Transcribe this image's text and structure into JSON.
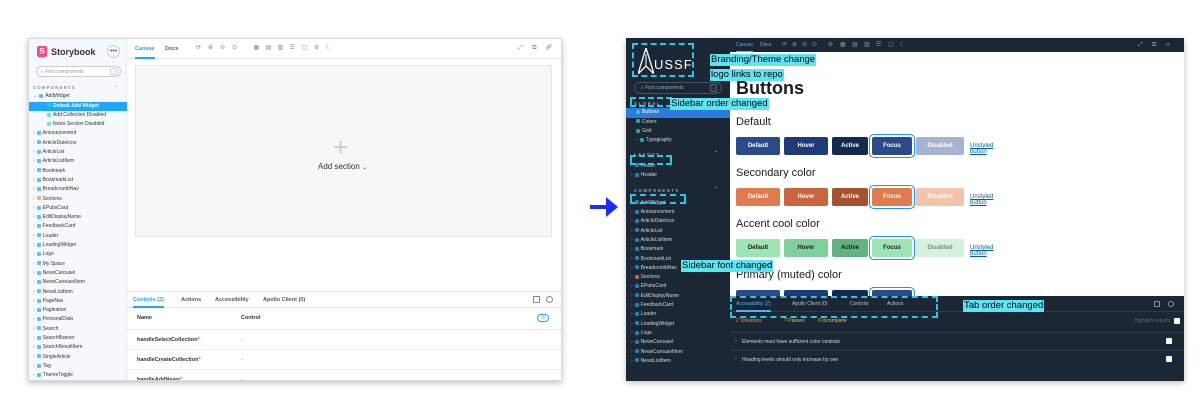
{
  "before": {
    "app_name": "Storybook",
    "search_placeholder": "Find components",
    "search_shortcut": "/",
    "sidebar_header": "COMPONENTS",
    "tree": [
      {
        "label": "AddWidget",
        "level": 0,
        "expanded": true
      },
      {
        "label": "Default Add Widget",
        "level": 2,
        "selected": true
      },
      {
        "label": "Add Collection Disabled",
        "level": 2
      },
      {
        "label": "News Section Disabled",
        "level": 2
      },
      {
        "label": "Announcement",
        "level": 0
      },
      {
        "label": "ArticleDateIcon",
        "level": 0
      },
      {
        "label": "ArticleList",
        "level": 0
      },
      {
        "label": "ArticleListItem",
        "level": 0
      },
      {
        "label": "Bookmark",
        "level": 0
      },
      {
        "label": "BookmarkList",
        "level": 0
      },
      {
        "label": "BreadcrumbNav",
        "level": 0
      },
      {
        "label": "Sections",
        "level": 0
      },
      {
        "label": "EPubsCard",
        "level": 0
      },
      {
        "label": "EditDisplayName",
        "level": 0
      },
      {
        "label": "FeedbackCard",
        "level": 0
      },
      {
        "label": "Loader",
        "level": 0
      },
      {
        "label": "LoadingWidget",
        "level": 0
      },
      {
        "label": "Logo",
        "level": 0
      },
      {
        "label": "My Space",
        "level": 0
      },
      {
        "label": "NewsCarousel",
        "level": 0
      },
      {
        "label": "NewsCarouselItem",
        "level": 0
      },
      {
        "label": "NewsListItem",
        "level": 0
      },
      {
        "label": "PageNav",
        "level": 0
      },
      {
        "label": "Pagination",
        "level": 0
      },
      {
        "label": "PersonalData",
        "level": 0
      },
      {
        "label": "Search",
        "level": 0
      },
      {
        "label": "SearchBanner",
        "level": 0
      },
      {
        "label": "SearchResultItem",
        "level": 0
      },
      {
        "label": "SingleArticle",
        "level": 0
      },
      {
        "label": "Tag",
        "level": 0
      },
      {
        "label": "ThemeToggle",
        "level": 0
      }
    ],
    "toolbar_tabs": [
      "Canvas",
      "Docs"
    ],
    "add_section": "Add section",
    "panel_tabs": [
      "Controls (2)",
      "Actions",
      "Accessibility",
      "Apollo Client (0)"
    ],
    "table_headers": [
      "Name",
      "Control"
    ],
    "controls": [
      {
        "name": "handleSelectCollection",
        "value": "-"
      },
      {
        "name": "handleCreateCollection",
        "value": "-"
      },
      {
        "name": "handleAddNews",
        "value": "-"
      }
    ]
  },
  "after": {
    "logo_text": "USSF",
    "search_placeholder": "Find components",
    "search_shortcut": "/",
    "groups": [
      {
        "header": "GLOBAL",
        "items": [
          "Buttons",
          "Colors",
          "Grid",
          "Typography"
        ]
      },
      {
        "header": "LAYOUT",
        "items": [
          "Footer",
          "Header"
        ]
      },
      {
        "header": "COMPONENTS",
        "items": [
          "AddWidget",
          "Announcement",
          "ArticleDateIcon",
          "ArticleList",
          "ArticleListItem",
          "Bookmark",
          "BookmarkList",
          "BreadcrumbNav",
          "Sections",
          "EPubsCard",
          "EditDisplayName",
          "FeedbackCard",
          "Loader",
          "LoadingWidget",
          "Logo",
          "NewsCarousel",
          "NewsCarouselItem",
          "NewsListItem"
        ]
      }
    ],
    "toolbar_tabs": [
      "Canvas",
      "Docs"
    ],
    "page_title": "Buttons",
    "sections": [
      {
        "title": "Default",
        "buttons": [
          "Default",
          "Hover",
          "Active",
          "Focus",
          "Disabled"
        ],
        "link": "Unstyled button"
      },
      {
        "title": "Secondary color",
        "buttons": [
          "Default",
          "Hover",
          "Active",
          "Focus",
          "Disabled"
        ],
        "link": "Unstyled button"
      },
      {
        "title": "Accent cool color",
        "buttons": [
          "Default",
          "Hover",
          "Active",
          "Focus",
          "Disabled"
        ],
        "link": "Unstyled button"
      },
      {
        "title": "Primary (muted) color"
      }
    ],
    "panel_tabs": [
      "Accessibility (2)",
      "Apollo Client (0)",
      "Controls",
      "Actions"
    ],
    "a11y": {
      "violations": "2 Violations",
      "passes": "7 Passes",
      "incomplete": "0 Incomplete",
      "highlight": "Highlight results"
    },
    "a11y_rows": [
      "Elements must have sufficient color contrast",
      "Heading levels should only increase by one"
    ]
  },
  "annotations": {
    "branding": "Branding/Theme change",
    "logo_link": "logo links to repo",
    "sidebar_order": "Sidebar order changed",
    "sidebar_font": "Sidebar font changed",
    "tab_order": "Tab order changed"
  },
  "colors": {
    "storybook_accent": "#1ea7fd",
    "arrow": "#1e2bff",
    "annotation_bg": "#5ce5f0",
    "dash": "#2ac6e3",
    "dark_sidebar": "#1b2735"
  }
}
